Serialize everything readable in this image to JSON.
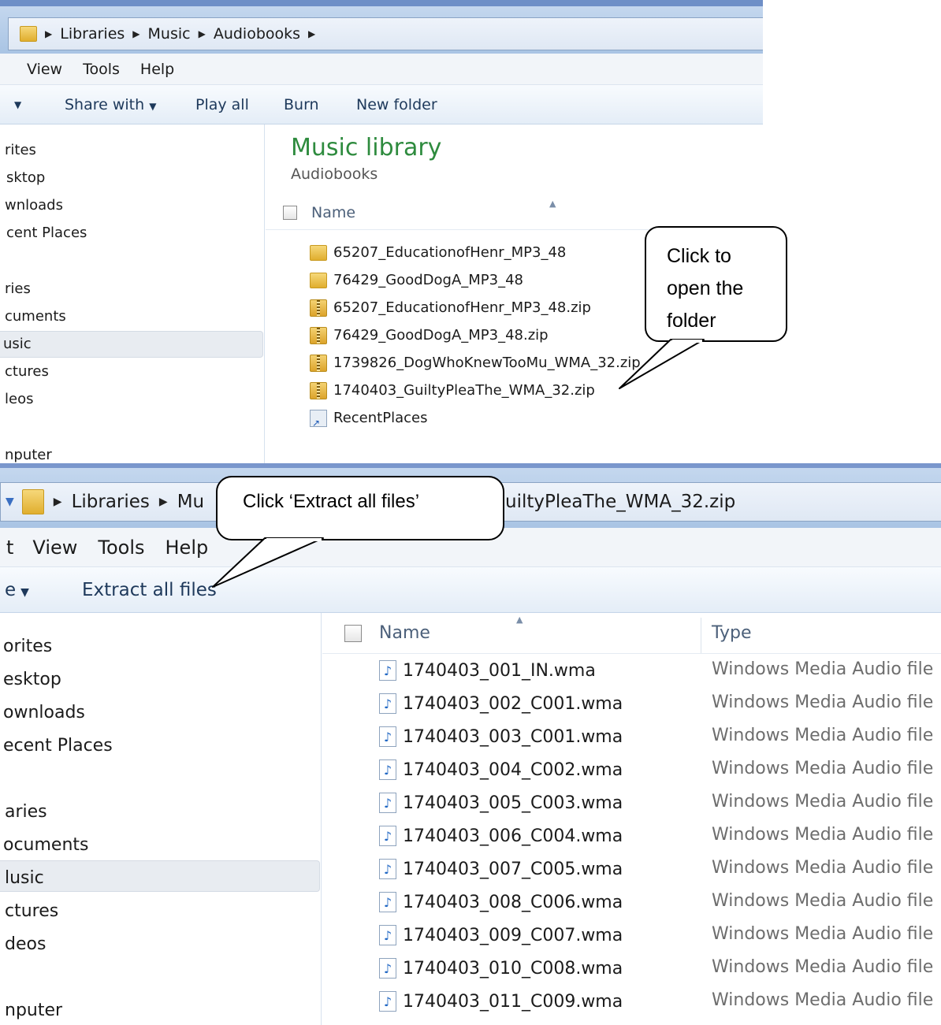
{
  "window1": {
    "breadcrumb": [
      "Libraries",
      "Music",
      "Audiobooks"
    ],
    "menu": [
      "View",
      "Tools",
      "Help"
    ],
    "toolbar": {
      "share_with": "Share with",
      "play_all": "Play all",
      "burn": "Burn",
      "new_folder": "New folder"
    },
    "nav_items": [
      "rites",
      "sktop",
      "wnloads",
      "cent Places",
      "ries",
      "cuments",
      "usic",
      "ctures",
      "leos",
      "nputer"
    ],
    "library_title": "Music library",
    "library_subtitle": "Audiobooks",
    "column_name": "Name",
    "files": [
      {
        "name": "65207_EducationofHenr_MP3_48",
        "icon": "folder-icon"
      },
      {
        "name": "76429_GoodDogA_MP3_48",
        "icon": "folder-icon"
      },
      {
        "name": "65207_EducationofHenr_MP3_48.zip",
        "icon": "zip-folder-icon"
      },
      {
        "name": "76429_GoodDogA_MP3_48.zip",
        "icon": "zip-folder-icon"
      },
      {
        "name": "1739826_DogWhoKnewTooMu_WMA_32.zip",
        "icon": "zip-folder-icon"
      },
      {
        "name": "1740403_GuiltyPleaThe_WMA_32.zip",
        "icon": "zip-folder-icon"
      },
      {
        "name": "RecentPlaces",
        "icon": "shortcut-icon"
      }
    ],
    "callout": [
      "Click to",
      "open the",
      "folder"
    ]
  },
  "window2": {
    "breadcrumb_start": [
      "Libraries",
      "Mu"
    ],
    "breadcrumb_end": "uiltyPleaThe_WMA_32.zip",
    "menu": [
      "t",
      "View",
      "Tools",
      "Help"
    ],
    "toolbar": {
      "organize_fragment": "e",
      "extract_all": "Extract all files"
    },
    "nav_items": [
      "orites",
      "esktop",
      "ownloads",
      "ecent Places",
      "aries",
      "ocuments",
      "lusic",
      "ctures",
      "deos",
      "nputer"
    ],
    "column_name": "Name",
    "column_type": "Type",
    "files": [
      {
        "name": "1740403_001_IN.wma",
        "type": "Windows Media Audio file"
      },
      {
        "name": "1740403_002_C001.wma",
        "type": "Windows Media Audio file"
      },
      {
        "name": "1740403_003_C001.wma",
        "type": "Windows Media Audio file"
      },
      {
        "name": "1740403_004_C002.wma",
        "type": "Windows Media Audio file"
      },
      {
        "name": "1740403_005_C003.wma",
        "type": "Windows Media Audio file"
      },
      {
        "name": "1740403_006_C004.wma",
        "type": "Windows Media Audio file"
      },
      {
        "name": "1740403_007_C005.wma",
        "type": "Windows Media Audio file"
      },
      {
        "name": "1740403_008_C006.wma",
        "type": "Windows Media Audio file"
      },
      {
        "name": "1740403_009_C007.wma",
        "type": "Windows Media Audio file"
      },
      {
        "name": "1740403_010_C008.wma",
        "type": "Windows Media Audio file"
      },
      {
        "name": "1740403_011_C009.wma",
        "type": "Windows Media Audio file"
      }
    ],
    "callout": "Click ‘Extract all files’"
  }
}
